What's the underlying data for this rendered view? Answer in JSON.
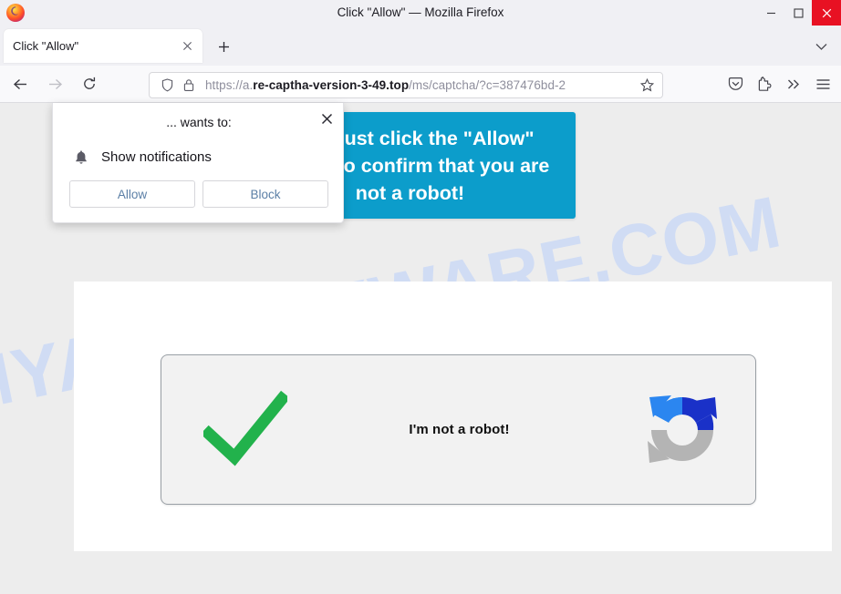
{
  "window": {
    "title": "Click \"Allow\" — Mozilla Firefox",
    "logo_icon": "firefox-logo",
    "controls": {
      "minimize": "minimize-icon",
      "maximize": "maximize-icon",
      "close": "close-icon"
    }
  },
  "tabstrip": {
    "tabs": [
      {
        "title": "Click \"Allow\"",
        "close_icon": "close-icon"
      }
    ],
    "new_tab_icon": "plus-icon",
    "list_all_tabs_icon": "chevron-down-icon"
  },
  "navbar": {
    "back_icon": "arrow-left-icon",
    "forward_icon": "arrow-right-icon",
    "reload_icon": "reload-icon",
    "shield_icon": "shield-icon",
    "lock_icon": "lock-icon",
    "bookmark_icon": "star-icon",
    "url": {
      "prefix": "https://a.",
      "host": "re-captha-version-3-49.top",
      "path": "/ms/captcha/?c=387476bd-2"
    },
    "right_icons": [
      "pocket-icon",
      "extensions-icon",
      "overflow-chevrons-icon",
      "hamburger-menu-icon"
    ]
  },
  "page": {
    "watermark": "MYANTISPYWARE.COM",
    "banner_text": "You must click the \"Allow\" button to confirm that you are not a robot!",
    "captcha": {
      "checkmark_icon": "green-checkmark-icon",
      "label": "I'm not a robot!",
      "refresh_icon": "recaptcha-refresh-icon"
    }
  },
  "permission_popup": {
    "heading": "... wants to:",
    "bell_icon": "bell-icon",
    "permission_label": "Show notifications",
    "allow_label": "Allow",
    "block_label": "Block",
    "close_icon": "close-icon"
  },
  "colors": {
    "banner_blue": "#0c9dcb",
    "checkmark_green": "#22b24c",
    "watermark_blue": "#cfdcf5",
    "close_button_red": "#e81123",
    "link_blue": "#5b7fa6"
  }
}
